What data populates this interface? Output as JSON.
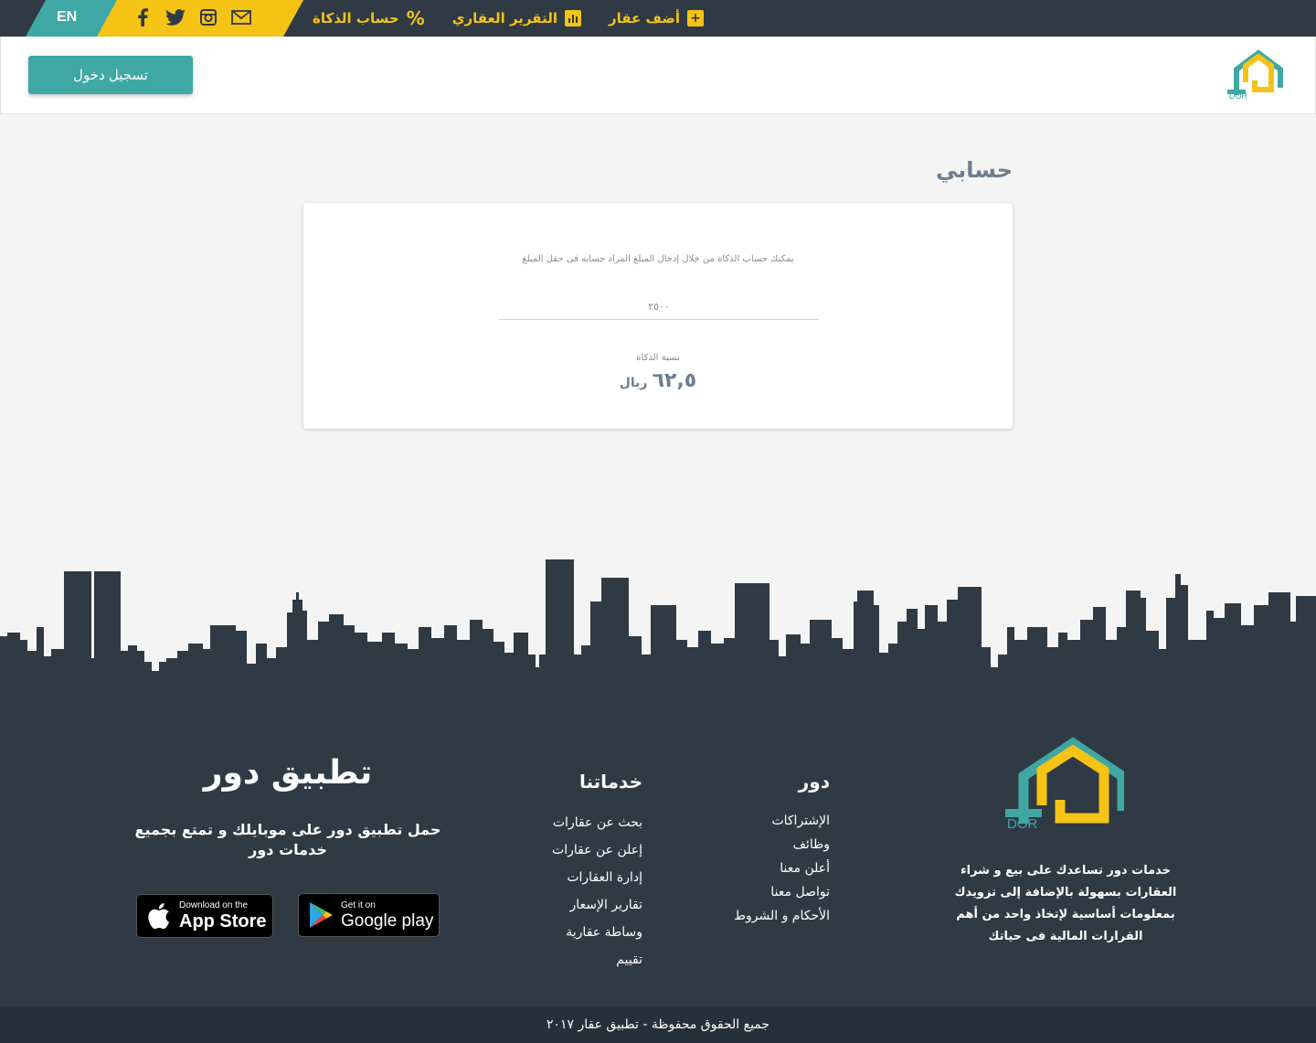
{
  "topbar": {
    "lang_label": "EN",
    "social": [
      {
        "icon": "facebook-icon",
        "glyph": "f"
      },
      {
        "icon": "twitter-icon",
        "glyph": "t"
      },
      {
        "icon": "instagram-icon",
        "glyph": "i"
      },
      {
        "icon": "mail-icon",
        "glyph": "m"
      }
    ],
    "links": {
      "zakat": {
        "label": "حساب الذكاة",
        "icon_glyph": "%"
      },
      "report": {
        "label": "التقرير العقاري"
      },
      "add": {
        "label": "أضف عقار",
        "icon_glyph": "+"
      }
    }
  },
  "header": {
    "login_label": "تسجيل دخول",
    "logo_text": "DOR"
  },
  "main": {
    "title": "حسابي",
    "hint": "يمكنك حساب الذكاة من خلال إدخال المبلغ المراد حسابه فى حقل المبلغ",
    "amount_value": "٢٥٠٠",
    "result_label": "نسبة الذكاة",
    "result_value": "٦٢,٥",
    "result_currency": "ريال"
  },
  "footer": {
    "logo_text": "DOR",
    "about": "خدمات دور تساعدك على بيع و شراء العقارات بسهولة بالإضافة إلى تزويدك بمعلومات أساسية لإتخاذ واحد من أهم القرارات المالية فى حياتك",
    "dor_col": {
      "title": "دور",
      "items": [
        "الإشتراكات",
        "وظائف",
        "أعلن معنا",
        "تواصل معنا",
        "الأحكام و الشروط"
      ]
    },
    "services_col": {
      "title": "خدماتنا",
      "items": [
        "بحث عن عقارات",
        "إعلن عن عقارات",
        "إدارة العقارات",
        "تقارير الإسعار",
        "وساطة عقارية",
        "تقييم"
      ]
    },
    "app": {
      "title": "تطبيق دور",
      "desc": "حمل تطبيق دور على موبايلك و تمتع بجميع خدمات دور",
      "apple_small": "Download on the",
      "apple_big": "App Store",
      "google_small": "Get it on",
      "google_big": "Google play"
    },
    "copyright": "جميع الحقوق محفوظة - تطبيق عقار ٢٠١٧"
  },
  "colors": {
    "dark": "#2f3a45",
    "teal": "#3fa8a4",
    "yellow": "#f5c313"
  }
}
